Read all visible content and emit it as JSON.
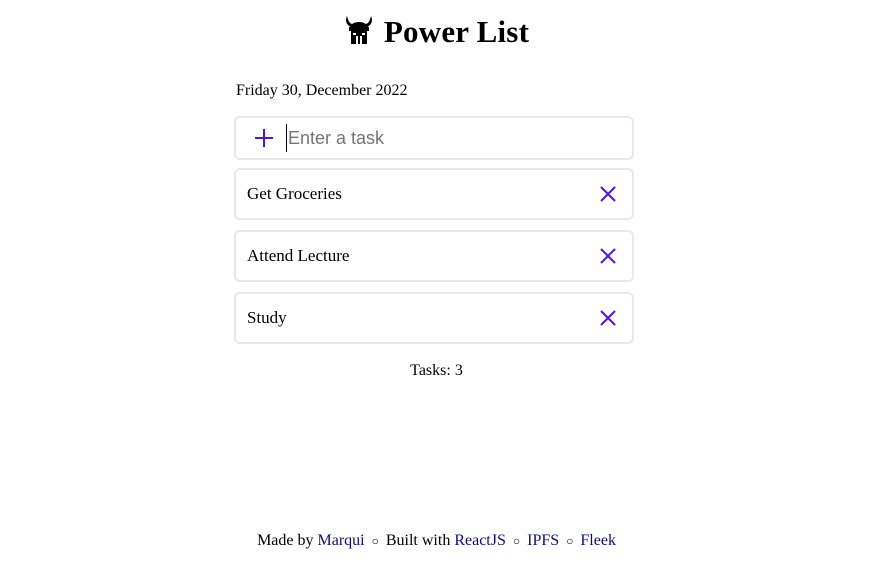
{
  "header": {
    "title": "Power List",
    "logo_icon": "viking-helmet-icon"
  },
  "date": "Friday 30, December 2022",
  "new_task": {
    "placeholder": "Enter a task",
    "value": "",
    "add_icon": "plus-icon"
  },
  "tasks": [
    {
      "label": "Get Groceries"
    },
    {
      "label": "Attend Lecture"
    },
    {
      "label": "Study"
    }
  ],
  "task_count": "Tasks: 3",
  "footer": {
    "made_by_text": "Made by",
    "author_link": "Marqui",
    "separator": "○",
    "built_with_text": "Built with",
    "react_link": "ReactJS",
    "ipfs_link": "IPFS",
    "fleek_link": "Fleek"
  },
  "colors": {
    "accent": "#4f14e6",
    "card_border": "#e8e8e8",
    "link": "#0b0b8a"
  }
}
